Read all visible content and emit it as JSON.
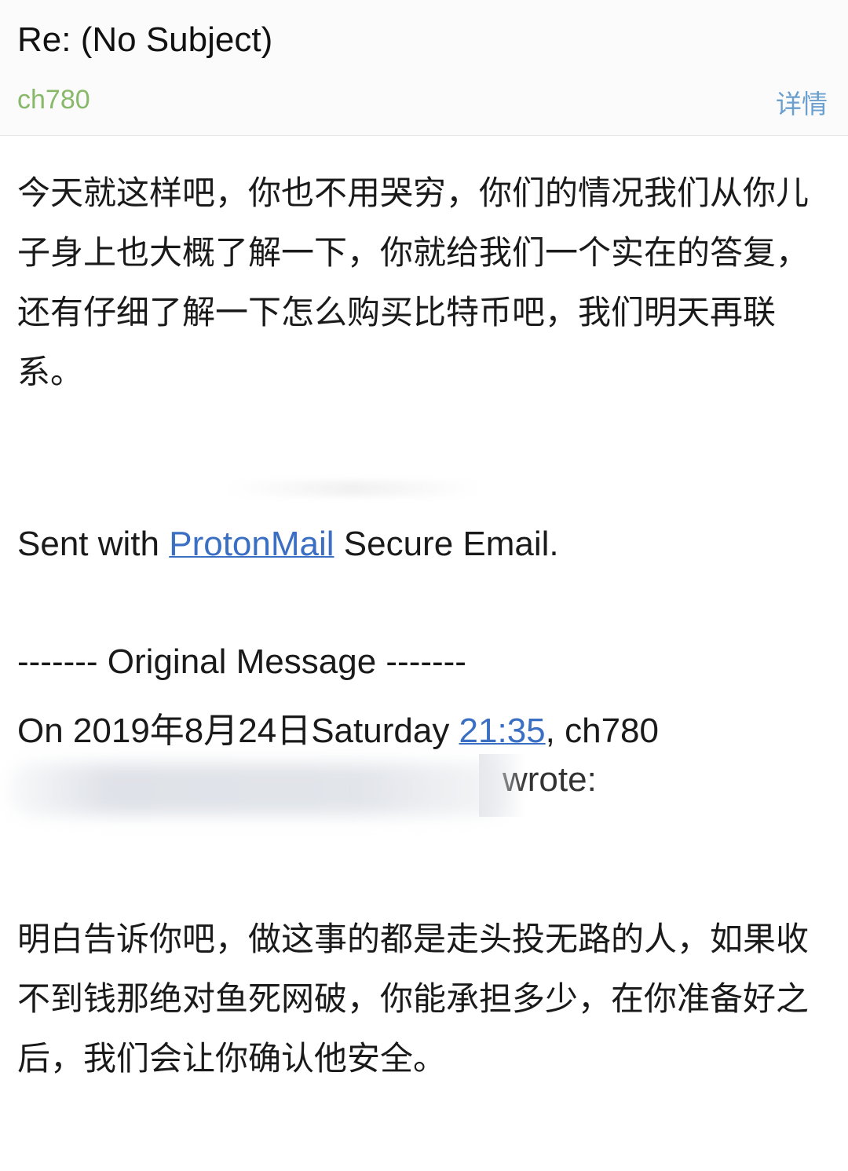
{
  "header": {
    "subject": "Re: (No Subject)",
    "sender": "ch780",
    "details_label": "详情"
  },
  "body": {
    "paragraph1": "今天就这样吧，你也不用哭穷，你们的情况我们从你儿子身上也大概了解一下，你就给我们一个实在的答复，还有仔细了解一下怎么购买比特币吧，我们明天再联系。",
    "sent_prefix": "Sent with ",
    "sent_link": "ProtonMail",
    "sent_suffix": " Secure Email.",
    "original_header": "------- Original Message -------",
    "on_prefix": "On 2019年8月24日Saturday ",
    "on_time": "21:35",
    "on_suffix": ", ch780",
    "wrote": "wrote:",
    "paragraph2": "明白告诉你吧，做这事的都是走头投无路的人，如果收不到钱那绝对鱼死网破，你能承担多少，在你准备好之后，我们会让你确认他安全。"
  },
  "colors": {
    "sender": "#88b86a",
    "details": "#6a9fce",
    "link": "#3a6fc4"
  }
}
